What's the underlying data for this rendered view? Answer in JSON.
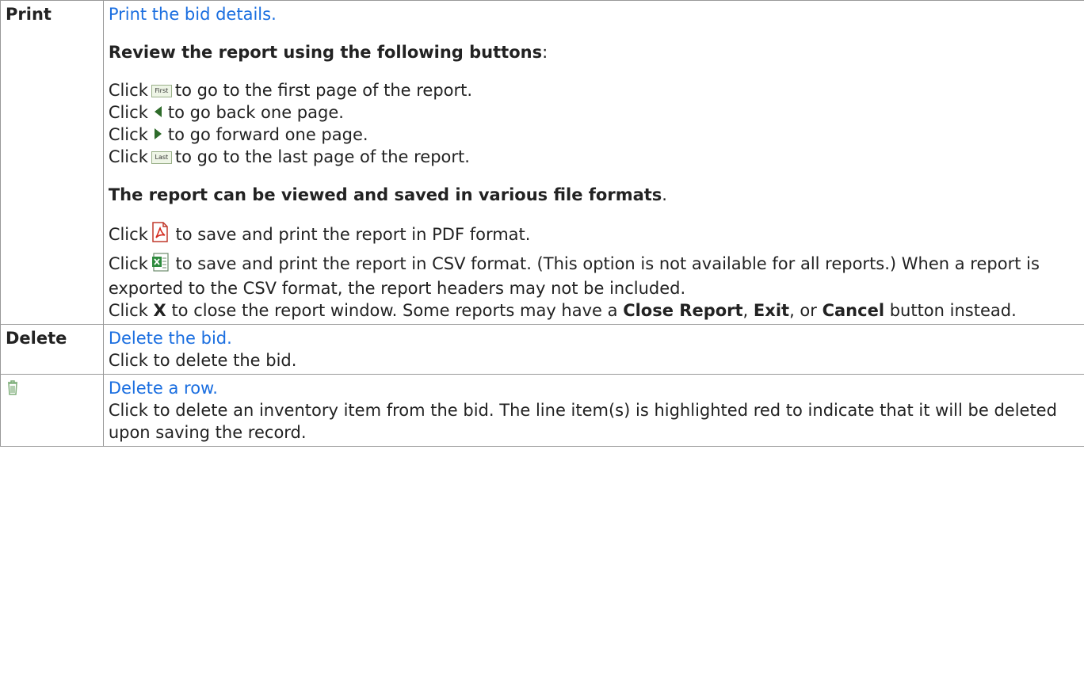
{
  "rows": {
    "print": {
      "label": "Print",
      "link": "Print the bid details.",
      "review_heading": "Review the report using the following buttons",
      "review_colon": ":",
      "nav": [
        {
          "icon": "first-button-icon",
          "icon_text": "First",
          "prefix": "Click",
          "text": "to go to the first page of the report."
        },
        {
          "icon": "previous-arrow-icon",
          "prefix": "Click",
          "text": "to go back one page."
        },
        {
          "icon": "next-arrow-icon",
          "prefix": "Click",
          "text": "to go forward one page."
        },
        {
          "icon": "last-button-icon",
          "icon_text": "Last",
          "prefix": "Click",
          "text": "to go to the last page of the report."
        }
      ],
      "formats_heading": "The report can be viewed and saved in various file formats",
      "formats_period": ".",
      "pdf": {
        "prefix": "Click",
        "text": "to save and print the report in PDF format."
      },
      "csv": {
        "prefix": "Click",
        "text": "to save and print the report in CSV format. (This option is not available for all reports.) When a report is exported to the CSV format, the report headers may not be included."
      },
      "close": {
        "prefix": "Click",
        "x": "X",
        "middle": "to close the report window. Some reports may have a",
        "close_report": "Close Report",
        "comma1": ",",
        "exit": "Exit",
        "comma2": ", or",
        "cancel": "Cancel",
        "suffix": "button instead."
      }
    },
    "delete": {
      "label": "Delete",
      "link": "Delete the bid.",
      "text": "Click to delete the bid."
    },
    "delete_row": {
      "icon": "trash-icon",
      "link": "Delete a row.",
      "text": "Click to delete an inventory item from the bid. The line item(s) is highlighted red to indicate that it will be deleted upon saving the record."
    }
  },
  "colors": {
    "link": "#1a6ee0",
    "border": "#999999",
    "text": "#222222"
  }
}
